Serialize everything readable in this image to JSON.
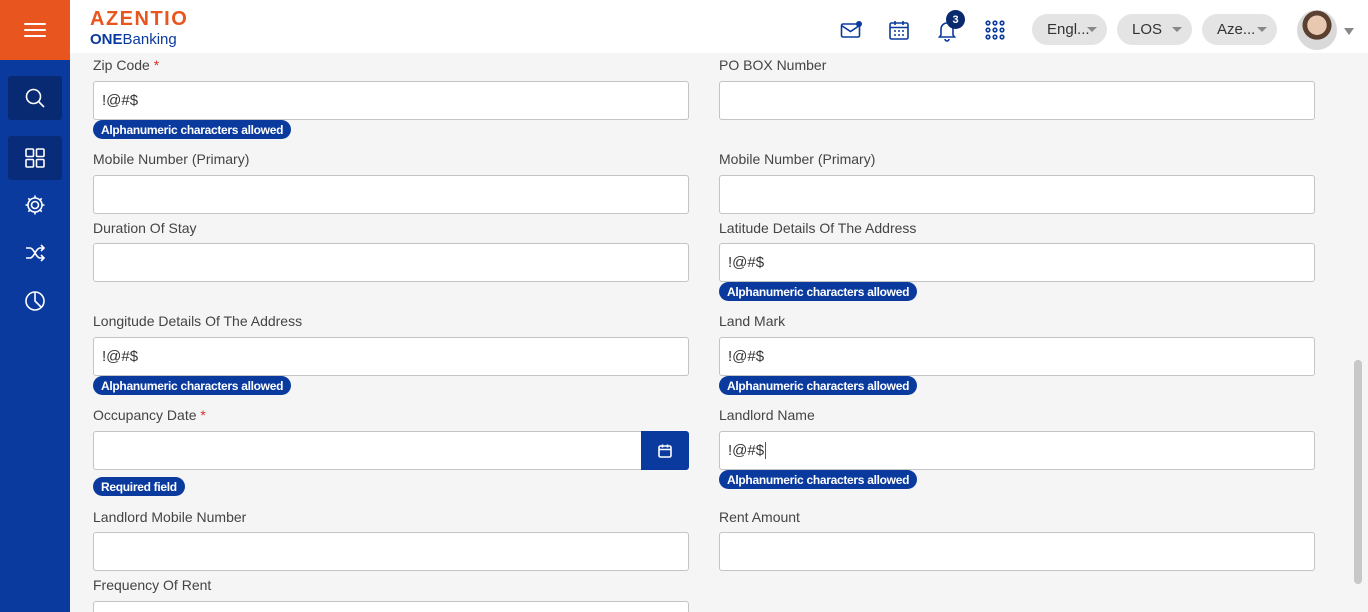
{
  "header": {
    "logo_main": "AZENTIO",
    "logo_sub_bold": "ONE",
    "logo_sub_rest": "Banking",
    "notification_count": "3",
    "language": "Engl...",
    "module": "LOS",
    "entity": "Aze..."
  },
  "icons": {
    "menu": "menu-icon",
    "search": "search-icon",
    "dashboard": "grid-icon",
    "settings": "gear-icon",
    "workflow": "shuffle-icon",
    "reports": "pie-chart-icon",
    "mail": "mail-icon",
    "calendar": "calendar-icon",
    "bell": "bell-icon",
    "apps": "apps-icon"
  },
  "colors": {
    "brand_orange": "#e8551f",
    "brand_blue": "#0a3a9e",
    "required": "#d93025"
  },
  "form": {
    "zip_code": {
      "label": "Zip Code",
      "required": "*",
      "value": "!@#$",
      "hint": "Alphanumeric characters allowed"
    },
    "po_box": {
      "label": "PO BOX Number",
      "value": ""
    },
    "mobile_primary_1": {
      "label": "Mobile Number (Primary)",
      "value": ""
    },
    "mobile_primary_2": {
      "label": "Mobile Number (Primary)",
      "value": ""
    },
    "duration_of_stay": {
      "label": "Duration Of Stay",
      "value": ""
    },
    "latitude": {
      "label": "Latitude Details Of The Address",
      "value": "!@#$",
      "hint": "Alphanumeric characters allowed"
    },
    "longitude": {
      "label": "Longitude Details Of The Address",
      "value": "!@#$",
      "hint": "Alphanumeric characters allowed"
    },
    "land_mark": {
      "label": "Land Mark",
      "value": "!@#$",
      "hint": "Alphanumeric characters allowed"
    },
    "occupancy_date": {
      "label": "Occupancy Date",
      "required": "*",
      "value": "",
      "hint": "Required field"
    },
    "landlord_name": {
      "label": "Landlord Name",
      "value": "!@#$",
      "hint": "Alphanumeric characters allowed"
    },
    "landlord_mobile": {
      "label": "Landlord Mobile Number",
      "value": ""
    },
    "rent_amount": {
      "label": "Rent Amount",
      "value": ""
    },
    "frequency_of_rent": {
      "label": "Frequency Of Rent",
      "value": ""
    }
  }
}
